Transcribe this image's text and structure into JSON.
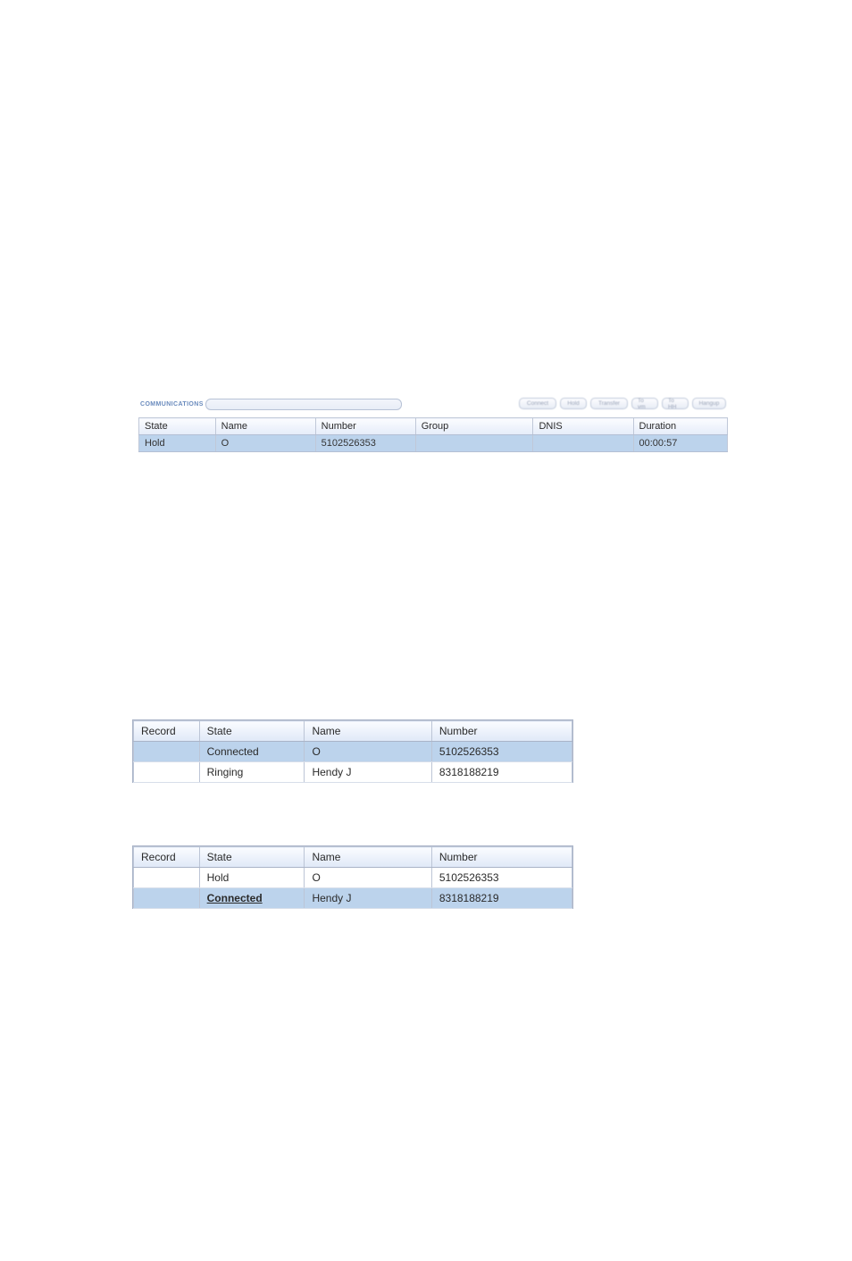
{
  "panel1": {
    "title": "COMMUNICATIONS",
    "buttons": [
      "Connect",
      "Hold",
      "Transfer",
      "To vm",
      "To HH",
      "Hangup"
    ],
    "columns": [
      "State",
      "Name",
      "Number",
      "Group",
      "DNIS",
      "Duration"
    ],
    "rows": [
      {
        "state": "Hold",
        "name": "O",
        "number": "5102526353",
        "group": "",
        "dnis": "",
        "duration": "00:00:57",
        "selected": true
      }
    ]
  },
  "panel2": {
    "columns": [
      "Record",
      "State",
      "Name",
      "Number"
    ],
    "rows": [
      {
        "record": "",
        "state": "Connected",
        "state_em": false,
        "name": "O",
        "number": "5102526353",
        "selected": true
      },
      {
        "record": "",
        "state": "Ringing",
        "state_em": false,
        "name": "Hendy J",
        "number": "8318188219",
        "selected": false
      }
    ]
  },
  "panel3": {
    "columns": [
      "Record",
      "State",
      "Name",
      "Number"
    ],
    "rows": [
      {
        "record": "",
        "state": "Hold",
        "state_em": false,
        "name": "O",
        "number": "5102526353",
        "selected": false
      },
      {
        "record": "",
        "state": "Connected",
        "state_em": true,
        "name": "Hendy J",
        "number": "8318188219",
        "selected": true
      }
    ]
  }
}
